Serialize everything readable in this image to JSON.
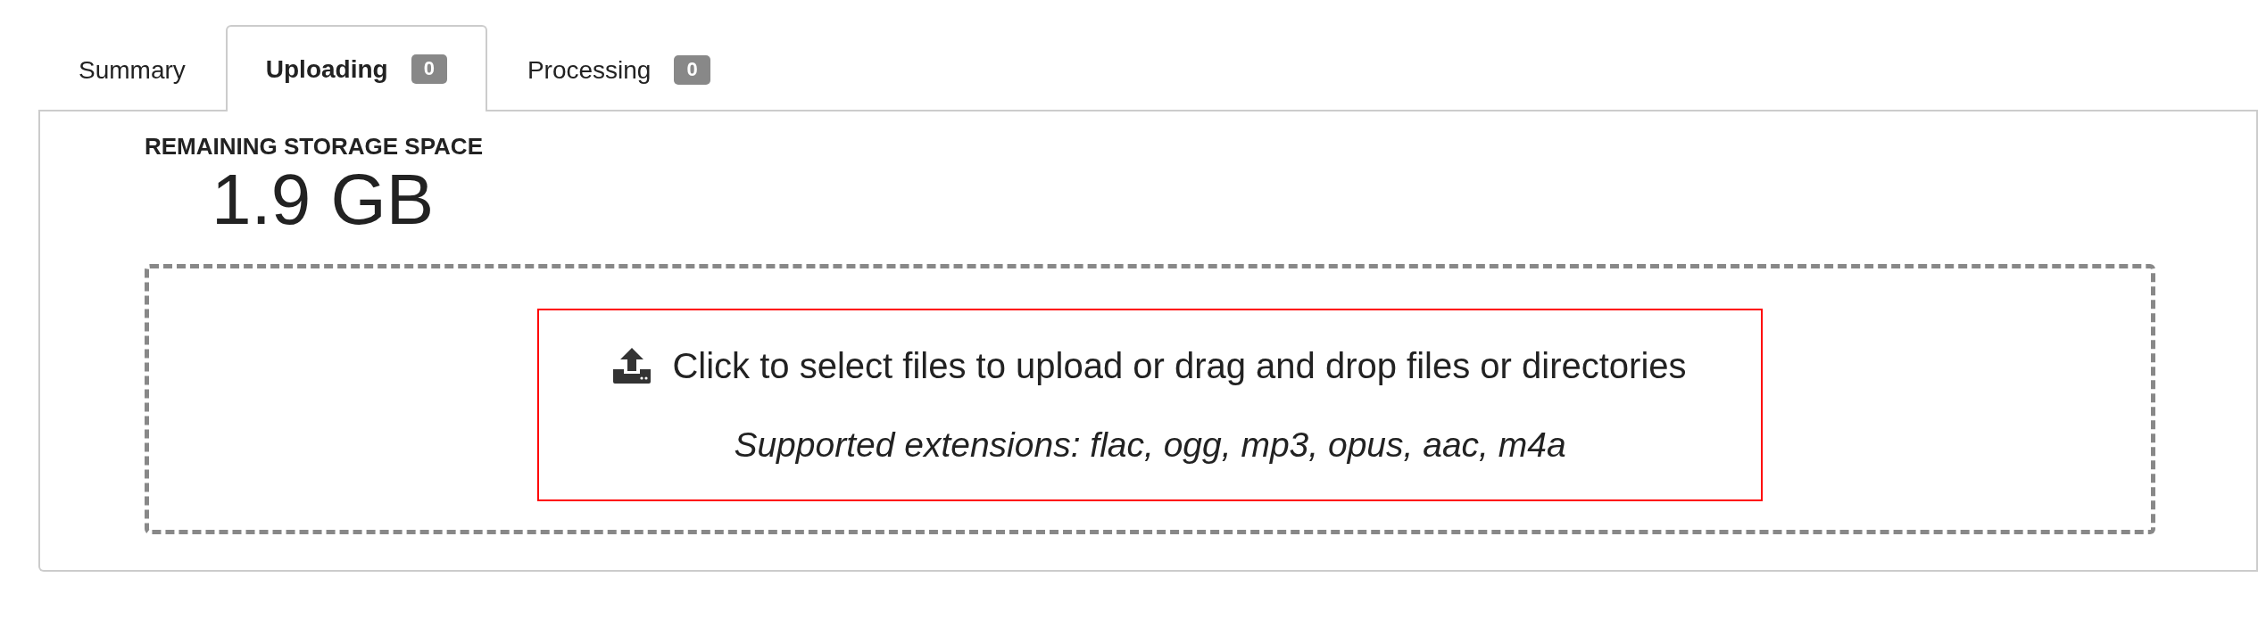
{
  "tabs": [
    {
      "label": "Summary",
      "selected": false
    },
    {
      "label": "Uploading",
      "selected": true,
      "count": "0"
    },
    {
      "label": "Processing",
      "selected": false,
      "count": "0"
    }
  ],
  "storage": {
    "label": "REMAINING STORAGE SPACE",
    "value": "1.9 GB"
  },
  "dropzone": {
    "prompt": "Click to select files to upload or drag and drop files or directories",
    "extensions": "Supported extensions: flac, ogg, mp3, opus, aac, m4a"
  }
}
